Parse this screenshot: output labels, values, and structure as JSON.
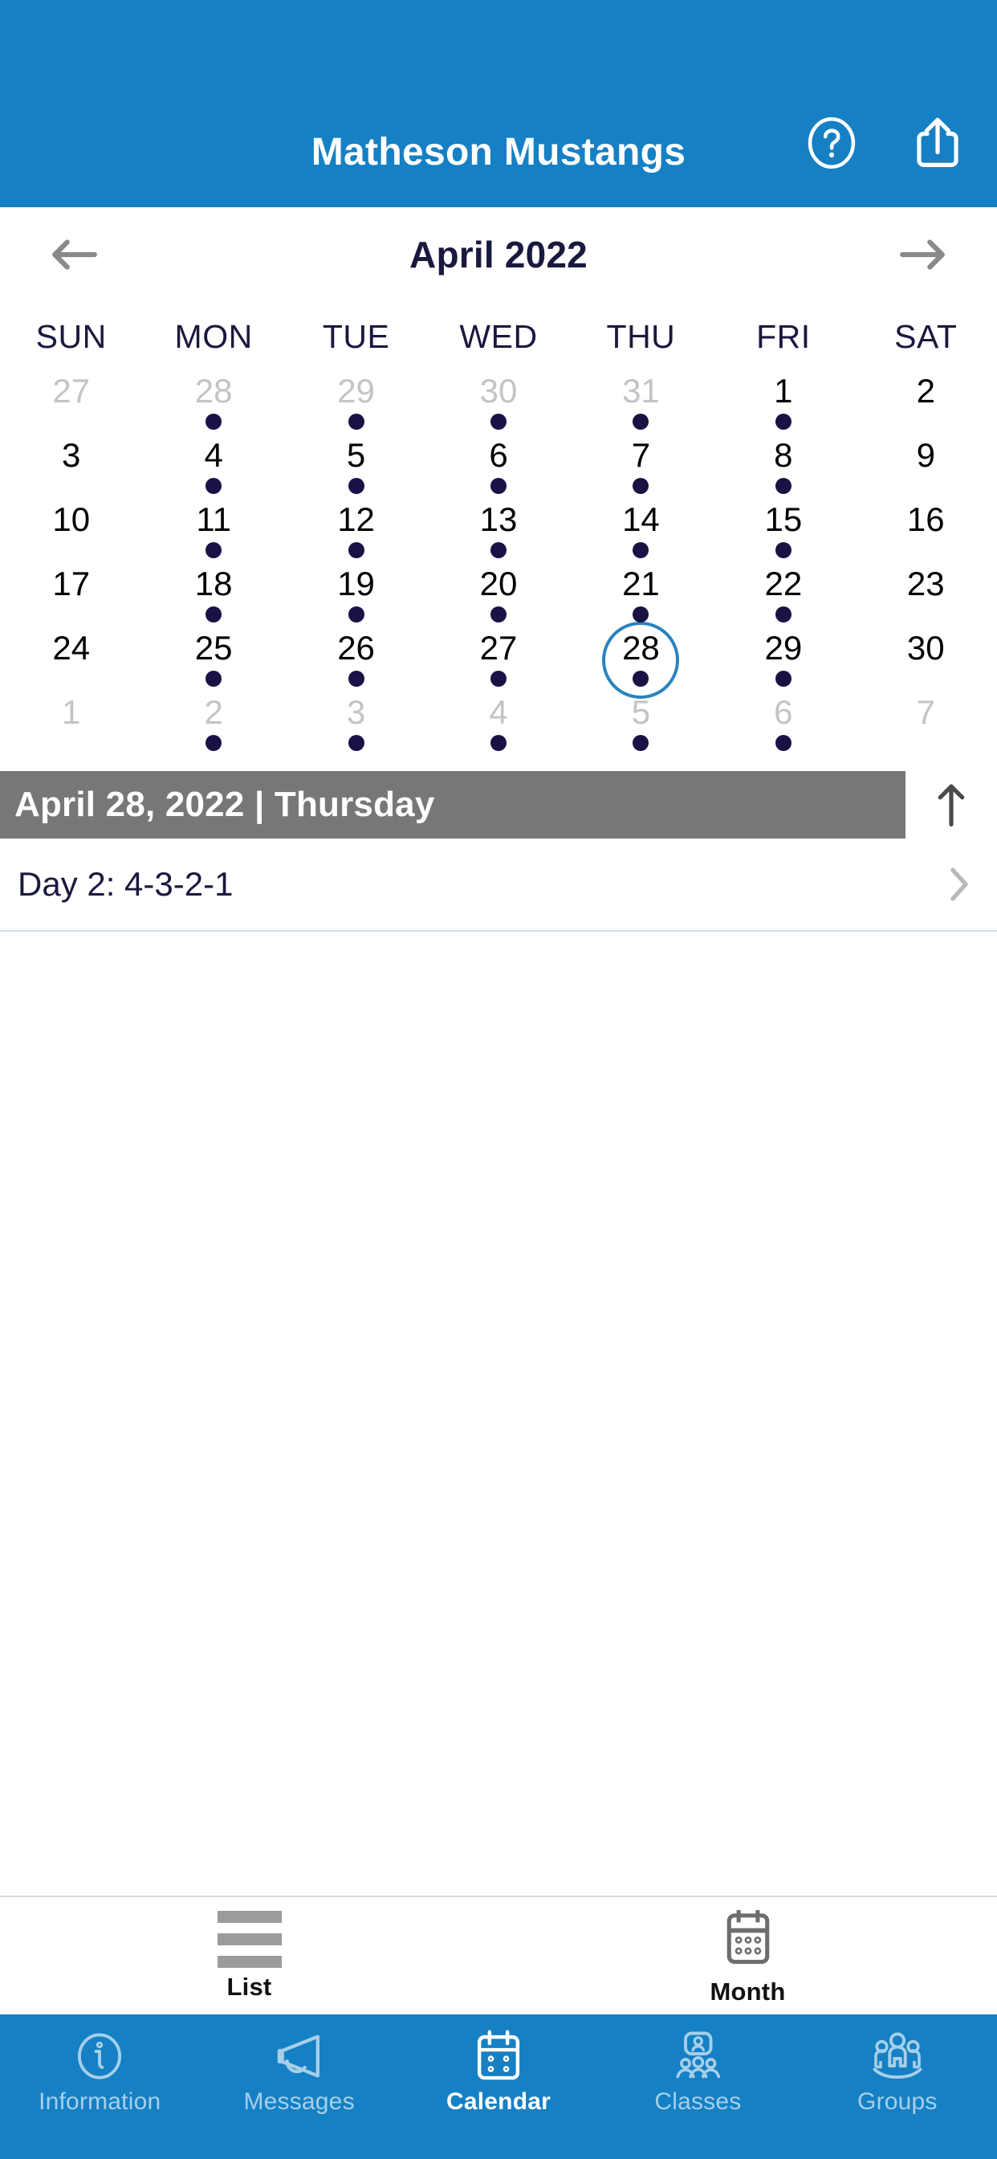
{
  "header": {
    "title": "Matheson Mustangs",
    "help_icon": "help-circle-icon",
    "share_icon": "share-icon"
  },
  "calendar": {
    "month_label": "April 2022",
    "prev_icon": "arrow-left-icon",
    "next_icon": "arrow-right-icon",
    "weekdays": [
      "SUN",
      "MON",
      "TUE",
      "WED",
      "THU",
      "FRI",
      "SAT"
    ],
    "selected_day": 28,
    "accent_color": "#2a83bd",
    "dot_color": "#1b1145",
    "muted_color": "#c4c4c4",
    "days": [
      {
        "n": "27",
        "muted": true,
        "dot": false
      },
      {
        "n": "28",
        "muted": true,
        "dot": true
      },
      {
        "n": "29",
        "muted": true,
        "dot": true
      },
      {
        "n": "30",
        "muted": true,
        "dot": true
      },
      {
        "n": "31",
        "muted": true,
        "dot": true
      },
      {
        "n": "1",
        "muted": false,
        "dot": true
      },
      {
        "n": "2",
        "muted": false,
        "dot": false
      },
      {
        "n": "3",
        "muted": false,
        "dot": false
      },
      {
        "n": "4",
        "muted": false,
        "dot": true
      },
      {
        "n": "5",
        "muted": false,
        "dot": true
      },
      {
        "n": "6",
        "muted": false,
        "dot": true
      },
      {
        "n": "7",
        "muted": false,
        "dot": true
      },
      {
        "n": "8",
        "muted": false,
        "dot": true
      },
      {
        "n": "9",
        "muted": false,
        "dot": false
      },
      {
        "n": "10",
        "muted": false,
        "dot": false
      },
      {
        "n": "11",
        "muted": false,
        "dot": true
      },
      {
        "n": "12",
        "muted": false,
        "dot": true
      },
      {
        "n": "13",
        "muted": false,
        "dot": true
      },
      {
        "n": "14",
        "muted": false,
        "dot": true
      },
      {
        "n": "15",
        "muted": false,
        "dot": true
      },
      {
        "n": "16",
        "muted": false,
        "dot": false
      },
      {
        "n": "17",
        "muted": false,
        "dot": false
      },
      {
        "n": "18",
        "muted": false,
        "dot": true
      },
      {
        "n": "19",
        "muted": false,
        "dot": true
      },
      {
        "n": "20",
        "muted": false,
        "dot": true
      },
      {
        "n": "21",
        "muted": false,
        "dot": true
      },
      {
        "n": "22",
        "muted": false,
        "dot": true
      },
      {
        "n": "23",
        "muted": false,
        "dot": false
      },
      {
        "n": "24",
        "muted": false,
        "dot": false
      },
      {
        "n": "25",
        "muted": false,
        "dot": true
      },
      {
        "n": "26",
        "muted": false,
        "dot": true
      },
      {
        "n": "27",
        "muted": false,
        "dot": true
      },
      {
        "n": "28",
        "muted": false,
        "dot": true,
        "selected": true
      },
      {
        "n": "29",
        "muted": false,
        "dot": true
      },
      {
        "n": "30",
        "muted": false,
        "dot": false
      },
      {
        "n": "1",
        "muted": true,
        "dot": false
      },
      {
        "n": "2",
        "muted": true,
        "dot": true
      },
      {
        "n": "3",
        "muted": true,
        "dot": true
      },
      {
        "n": "4",
        "muted": true,
        "dot": true
      },
      {
        "n": "5",
        "muted": true,
        "dot": true
      },
      {
        "n": "6",
        "muted": true,
        "dot": true
      },
      {
        "n": "7",
        "muted": true,
        "dot": false
      }
    ]
  },
  "selected_date_bar": {
    "text": "April 28, 2022 | Thursday",
    "background": "#777777",
    "collapse_icon": "arrow-up-icon"
  },
  "events": [
    {
      "title": "Day 2: 4-3-2-1",
      "chevron_icon": "chevron-right-icon"
    }
  ],
  "view_toggle": {
    "items": [
      {
        "label": "List",
        "icon": "list-icon",
        "active": false
      },
      {
        "label": "Month",
        "icon": "calendar-icon",
        "active": true
      }
    ]
  },
  "tabbar": {
    "background": "#1580c4",
    "items": [
      {
        "label": "Information",
        "icon": "info-circle-icon",
        "active": false
      },
      {
        "label": "Messages",
        "icon": "megaphone-icon",
        "active": false
      },
      {
        "label": "Calendar",
        "icon": "calendar-icon",
        "active": true
      },
      {
        "label": "Classes",
        "icon": "classes-icon",
        "active": false
      },
      {
        "label": "Groups",
        "icon": "groups-icon",
        "active": false
      }
    ]
  }
}
